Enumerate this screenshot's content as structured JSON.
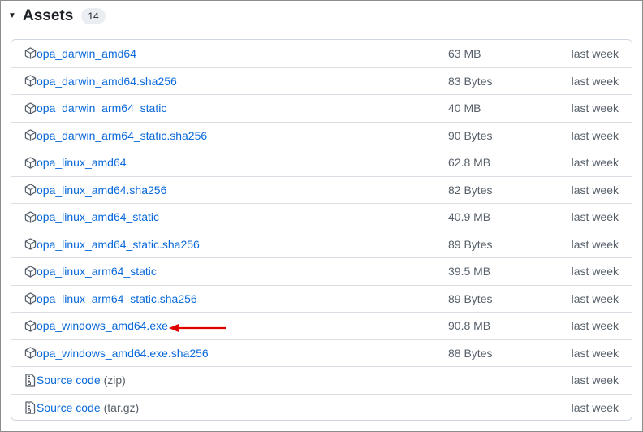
{
  "section": {
    "title": "Assets",
    "count": "14"
  },
  "assets": [
    {
      "name": "opa_darwin_amd64",
      "suffix": "",
      "size": "63 MB",
      "date": "last week",
      "icon": "package-icon"
    },
    {
      "name": "opa_darwin_amd64.sha256",
      "suffix": "",
      "size": "83 Bytes",
      "date": "last week",
      "icon": "package-icon"
    },
    {
      "name": "opa_darwin_arm64_static",
      "suffix": "",
      "size": "40 MB",
      "date": "last week",
      "icon": "package-icon"
    },
    {
      "name": "opa_darwin_arm64_static.sha256",
      "suffix": "",
      "size": "90 Bytes",
      "date": "last week",
      "icon": "package-icon"
    },
    {
      "name": "opa_linux_amd64",
      "suffix": "",
      "size": "62.8 MB",
      "date": "last week",
      "icon": "package-icon"
    },
    {
      "name": "opa_linux_amd64.sha256",
      "suffix": "",
      "size": "82 Bytes",
      "date": "last week",
      "icon": "package-icon"
    },
    {
      "name": "opa_linux_amd64_static",
      "suffix": "",
      "size": "40.9 MB",
      "date": "last week",
      "icon": "package-icon"
    },
    {
      "name": "opa_linux_amd64_static.sha256",
      "suffix": "",
      "size": "89 Bytes",
      "date": "last week",
      "icon": "package-icon"
    },
    {
      "name": "opa_linux_arm64_static",
      "suffix": "",
      "size": "39.5 MB",
      "date": "last week",
      "icon": "package-icon"
    },
    {
      "name": "opa_linux_arm64_static.sha256",
      "suffix": "",
      "size": "89 Bytes",
      "date": "last week",
      "icon": "package-icon"
    },
    {
      "name": "opa_windows_amd64.exe",
      "suffix": "",
      "size": "90.8 MB",
      "date": "last week",
      "icon": "package-icon"
    },
    {
      "name": "opa_windows_amd64.exe.sha256",
      "suffix": "",
      "size": "88 Bytes",
      "date": "last week",
      "icon": "package-icon"
    },
    {
      "name": "Source code",
      "suffix": "(zip)",
      "size": "",
      "date": "last week",
      "icon": "file-zip-icon"
    },
    {
      "name": "Source code",
      "suffix": "(tar.gz)",
      "size": "",
      "date": "last week",
      "icon": "file-zip-icon"
    }
  ],
  "colors": {
    "link": "#0969da",
    "muted": "#57606a",
    "border": "#d0d7de",
    "annotation_arrow": "#e00000"
  }
}
